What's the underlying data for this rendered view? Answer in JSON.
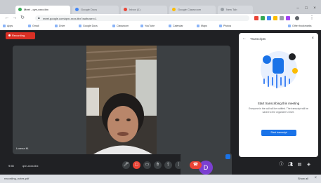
{
  "browser": {
    "tabs": [
      {
        "label": "Meet - qvn-xxxx-tbx",
        "color": "#34a853"
      },
      {
        "label": "Google Docs",
        "color": "#4285f4"
      },
      {
        "label": "Inbox (1)",
        "color": "#ea4335"
      },
      {
        "label": "Google Classroom",
        "color": "#fbbc04"
      },
      {
        "label": "New Tab",
        "color": "#9aa0a6"
      }
    ],
    "url": "meet.google.com/qvn-xxxx-tbx?authuser=1",
    "bookmarks": [
      "Apps",
      "Gmail",
      "Drive",
      "Google Docs",
      "Classroom",
      "YouTube",
      "Calendar",
      "Maps",
      "Photos",
      "Other bookmarks"
    ]
  },
  "meet": {
    "recording_label": "Recording",
    "participant_name": "Lorena M.",
    "self_initial": "D",
    "meeting_time": "9:55",
    "meeting_code": "qvn-xxxx-tbx",
    "panel": {
      "title": "Transcripts",
      "heading": "Start transcribing this meeting",
      "body": "Everyone in the call will be notified. The transcript will be saved to the organizer's Drive.",
      "button": "Start transcript"
    }
  },
  "download_bar": {
    "file": "recording_notes.pdf",
    "show_all": "Show all"
  }
}
